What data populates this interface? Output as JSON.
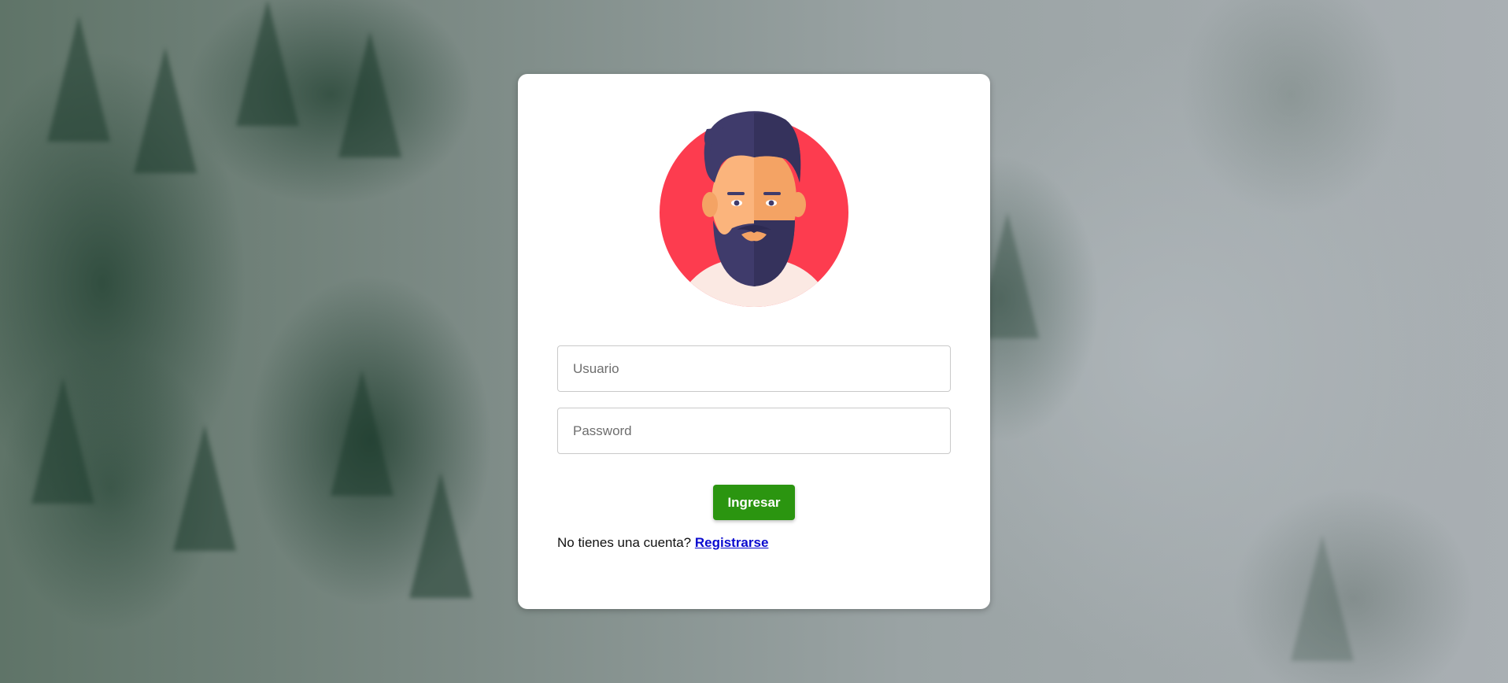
{
  "login": {
    "username_placeholder": "Usuario",
    "password_placeholder": "Password",
    "submit_label": "Ingresar",
    "register_prompt": "No tienes una cuenta?",
    "register_link": "Registrarse"
  },
  "icons": {
    "avatar": "bearded-man-avatar-icon"
  },
  "colors": {
    "submit_button": "#2b9510",
    "register_link": "#0a0acf",
    "avatar_circle": "#fd3c4f",
    "avatar_hair": "#3f3b6b"
  }
}
